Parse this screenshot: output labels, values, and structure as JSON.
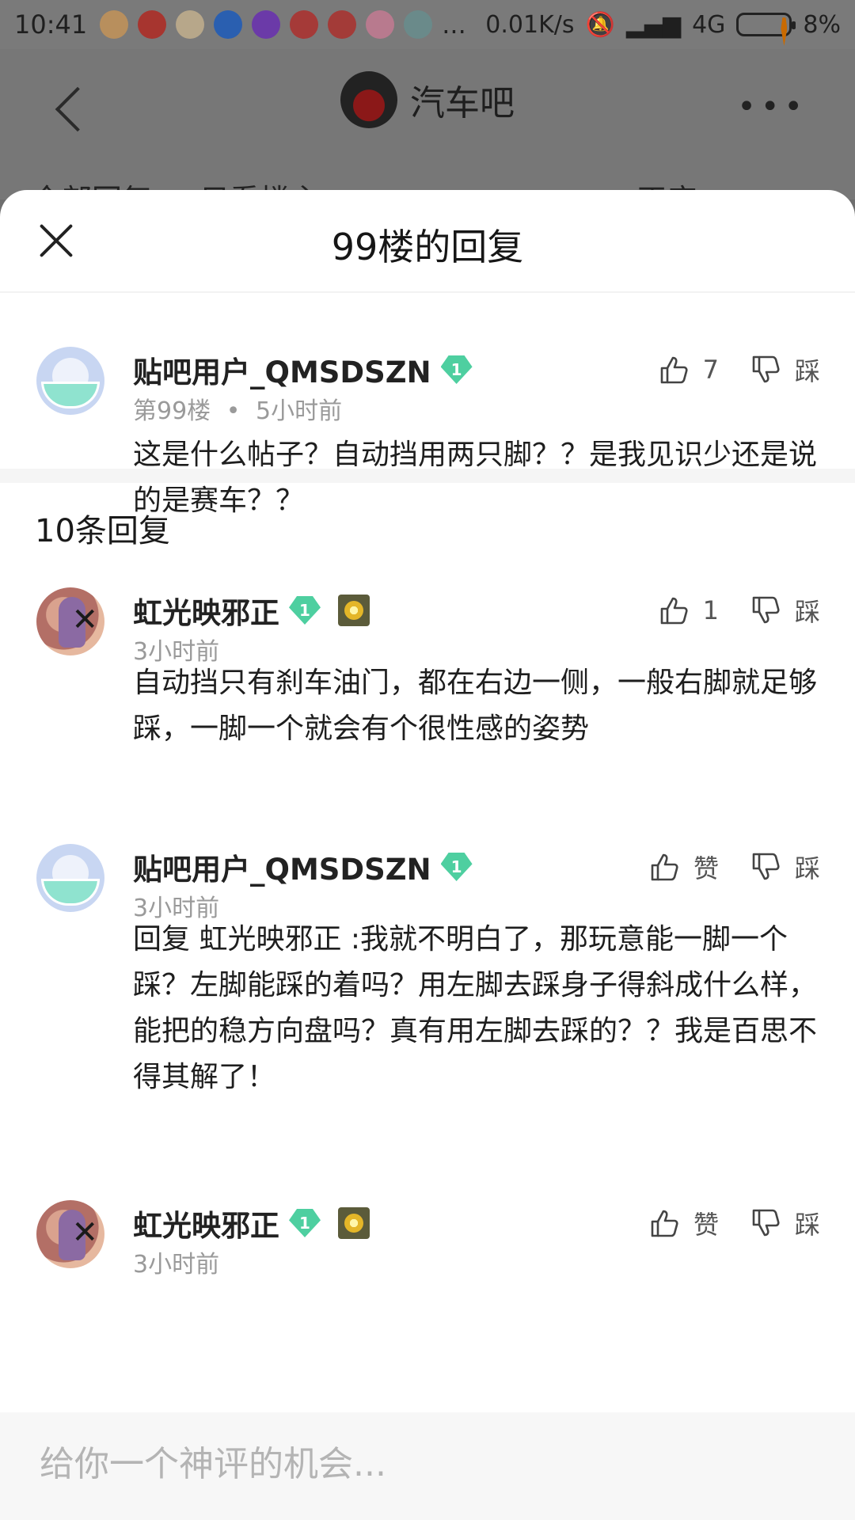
{
  "status_bar": {
    "time": "10:41",
    "speed": "0.01K/s",
    "network": "4G",
    "battery": "8%",
    "more": "..."
  },
  "header": {
    "forum_name": "汽车吧",
    "tabs": [
      "全部回复",
      "只看楼主",
      "正序"
    ]
  },
  "sheet": {
    "title": "99楼的回复",
    "reply_count": "10条回复",
    "input_placeholder": "给你一个神评的机会..."
  },
  "main_post": {
    "username": "贴吧用户_QMSDSZN",
    "level": "1",
    "floor": "第99楼",
    "separator": "•",
    "time": "5小时前",
    "likes": "7",
    "dislike_label": "踩",
    "text": "这是什么帖子？自动挡用两只脚？？是我见识少还是说的是赛车？？"
  },
  "replies": [
    {
      "username": "虹光映邪正",
      "level": "1",
      "time": "3小时前",
      "like_label": "1",
      "dislike_label": "踩",
      "text": "自动挡只有刹车油门，都在右边一侧，一般右脚就足够踩，一脚一个就会有个很性感的姿势"
    },
    {
      "username": "贴吧用户_QMSDSZN",
      "level": "1",
      "time": "3小时前",
      "like_label": "赞",
      "dislike_label": "踩",
      "text": "回复 虹光映邪正 :我就不明白了，那玩意能一脚一个踩？左脚能踩的着吗？用左脚去踩身子得斜成什么样，能把的稳方向盘吗？真有用左脚去踩的？？我是百思不得其解了！"
    },
    {
      "username": "虹光映邪正",
      "level": "1",
      "time": "3小时前",
      "like_label": "赞",
      "dislike_label": "踩",
      "text": ""
    }
  ]
}
